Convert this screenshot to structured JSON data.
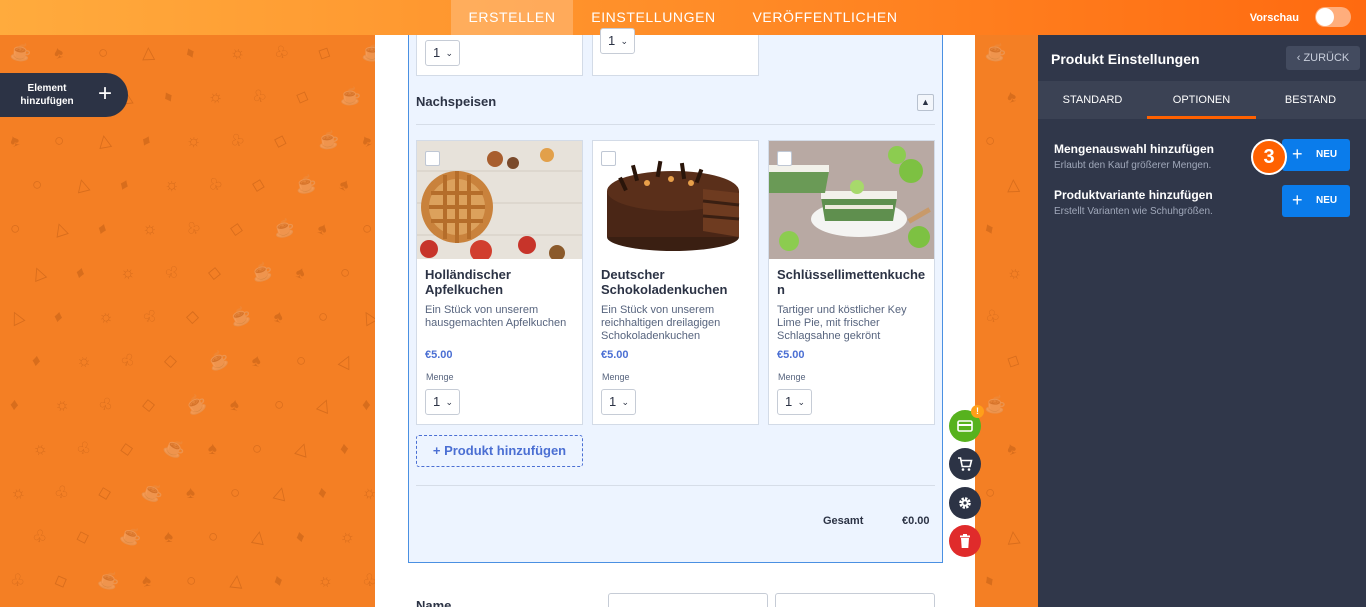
{
  "topbar": {
    "tabs": [
      "ERSTELLEN",
      "EINSTELLUNGEN",
      "VERÖFFENTLICHEN"
    ],
    "active_tab": "ERSTELLEN",
    "preview_label": "Vorschau"
  },
  "sidebar": {
    "add_element_label": "Element hinzufügen"
  },
  "form": {
    "top_quantities": [
      "1",
      "1"
    ],
    "section_title": "Nachspeisen",
    "products": [
      {
        "name": "Holländischer Apfelkuchen",
        "description": "Ein Stück von unserem hausgemachten Apfelkuchen",
        "price": "€5.00",
        "quantity_label": "Menge",
        "quantity": "1"
      },
      {
        "name": "Deutscher Schokoladenkuchen",
        "description": "Ein Stück von unserem reichhaltigen dreilagigen Schokoladenkuchen",
        "price": "€5.00",
        "quantity_label": "Menge",
        "quantity": "1"
      },
      {
        "name": "Schlüssellimettenkuchen",
        "description": "Tartiger und köstlicher Key Lime Pie, mit frischer Schlagsahne gekrönt",
        "price": "€5.00",
        "quantity_label": "Menge",
        "quantity": "1"
      }
    ],
    "add_product_label": "+ Produkt hinzufügen",
    "total_label": "Gesamt",
    "total_value": "€0.00",
    "next_field_label": "Name"
  },
  "floating_tools": {
    "badge": "!",
    "icons": [
      "payment-card-icon",
      "cart-icon",
      "gear-icon",
      "trash-icon"
    ],
    "colors": [
      "#57b21e",
      "#2c3345",
      "#2c3345",
      "#e02b2b"
    ]
  },
  "panel": {
    "title": "Produkt Einstellungen",
    "back_label": "ZURÜCK",
    "tabs": [
      "STANDARD",
      "OPTIONEN",
      "BESTAND"
    ],
    "active_tab": "OPTIONEN",
    "options": [
      {
        "title": "Mengenauswahl hinzufügen",
        "subtitle": "Erlaubt den Kauf größerer Mengen.",
        "button_label": "NEU"
      },
      {
        "title": "Produktvariante hinzufügen",
        "subtitle": "Erstellt Varianten wie Schuhgrößen.",
        "button_label": "NEU"
      }
    ],
    "step_number": "3"
  },
  "colors": {
    "accent": "#ff6100",
    "primary_button": "#0a7ceb",
    "panel_bg": "#30374a",
    "price": "#4b6fd3"
  }
}
